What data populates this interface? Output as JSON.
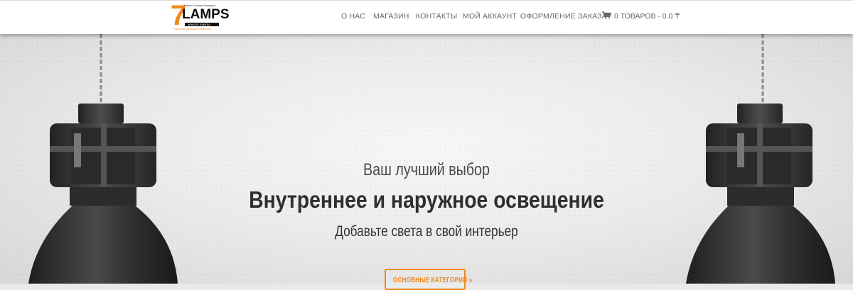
{
  "header": {
    "logo": {
      "digit": "7",
      "word": "LAMPS",
      "top_text": "Жамол Сапаш Алмаара",
      "bar_text": "ЖАМОЛ ЛАМПЫ",
      "tagline": "Гарантия Делимой Качества"
    },
    "nav": [
      {
        "label": "О НАС"
      },
      {
        "label": "МАГАЗИН"
      },
      {
        "label": "КОНТАКТЫ"
      },
      {
        "label": "МОЙ АККАУНТ"
      },
      {
        "label": "ОФОРМЛЕНИЕ ЗАКАЗА"
      }
    ],
    "cart": {
      "icon": "cart-icon",
      "label": "0 ТОВАРОВ - 0.0 ₸"
    }
  },
  "hero": {
    "subtitle": "Ваш лучший выбор",
    "title": "Внутреннее и наружное освещение",
    "tagline": "Добавьте света в свой интерьер",
    "cta_label": "ОСНОВНЫЕ КАТЕГОРИИ »"
  },
  "colors": {
    "accent": "#f08a1e",
    "nav_text": "#666666",
    "title_text": "#2f2f2f",
    "lamp_dark": "#3a3a3a"
  }
}
